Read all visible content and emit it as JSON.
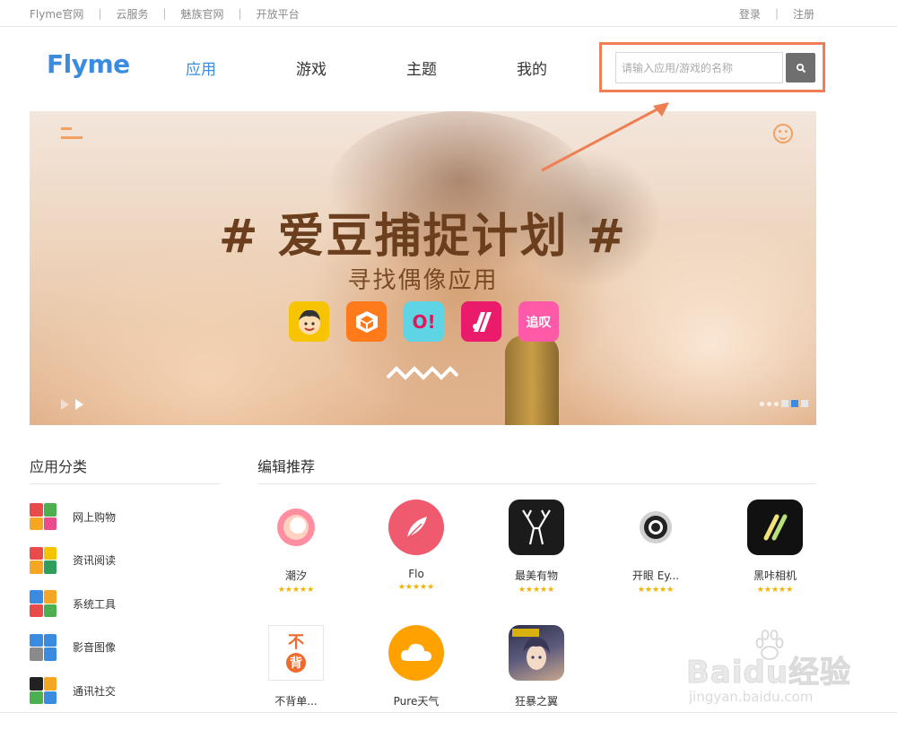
{
  "topbar": {
    "links": [
      "Flyme官网",
      "云服务",
      "魅族官网",
      "开放平台"
    ],
    "separator": "|",
    "login": "登录",
    "register": "注册"
  },
  "header": {
    "logo": "Flyme",
    "nav": [
      "应用",
      "游戏",
      "主题",
      "我的"
    ],
    "active_nav": "应用",
    "search_placeholder": "请输入应用/游戏的名称",
    "search_value": "",
    "search_icon": "search-icon",
    "highlight_color": "#ef7f52"
  },
  "banner": {
    "title": "# 爱豆捕捉计划 #",
    "subtitle": "寻找偶像应用",
    "app_icons": [
      {
        "name": "avatar-app-icon",
        "label": "",
        "color": "#f6c400"
      },
      {
        "name": "cube-app-icon",
        "label": "",
        "color": "#ff7a1a"
      },
      {
        "name": "o-app-icon",
        "label": "O!",
        "color": "#5fd4e4"
      },
      {
        "name": "slash-app-icon",
        "label": "",
        "color": "#ea1b6b"
      },
      {
        "name": "zhuiai-app-icon",
        "label": "追叹",
        "color": "#ff5aa8"
      }
    ],
    "carousel_current": 2,
    "carousel_total": 5
  },
  "categories": {
    "title": "应用分类",
    "items": [
      {
        "label": "网上购物",
        "colors": [
          "#e94b4b",
          "#4caf50",
          "#f5a623",
          "#e94b8b"
        ]
      },
      {
        "label": "资讯阅读",
        "colors": [
          "#e94b4b",
          "#f5c400",
          "#f5a623",
          "#2e9e5b"
        ]
      },
      {
        "label": "系统工具",
        "colors": [
          "#3b8ce0",
          "#f5a623",
          "#e94b4b",
          "#4caf50"
        ]
      },
      {
        "label": "影音图像",
        "colors": [
          "#3b8ce0",
          "#3b8ce0",
          "#8a8a8a",
          "#3b8ce0"
        ]
      },
      {
        "label": "通讯社交",
        "colors": [
          "#222222",
          "#f5a623",
          "#4caf50",
          "#3b8ce0"
        ]
      }
    ]
  },
  "picks": {
    "title": "编辑推荐",
    "items": [
      {
        "name": "潮汐",
        "rating": "★★★★★",
        "icon": "chaoxi-icon"
      },
      {
        "name": "Flo",
        "rating": "★★★★★",
        "icon": "flo-feather-icon"
      },
      {
        "name": "最美有物",
        "rating": "★★★★★",
        "icon": "deer-icon"
      },
      {
        "name": "开眼 Ey...",
        "rating": "★★★★★",
        "icon": "eye-icon"
      },
      {
        "name": "黑咔相机",
        "rating": "★★★★★",
        "icon": "hika-camera-icon"
      },
      {
        "name": "不背单...",
        "rating": "",
        "icon": "bubei-icon",
        "glyph_top": "不",
        "glyph_bottom": "背"
      },
      {
        "name": "Pure天气",
        "rating": "",
        "icon": "cloud-icon"
      },
      {
        "name": "狂暴之翼",
        "rating": "",
        "icon": "game-character-icon"
      }
    ]
  },
  "watermark": {
    "brand": "Baidu经验",
    "url": "jingyan.baidu.com"
  }
}
